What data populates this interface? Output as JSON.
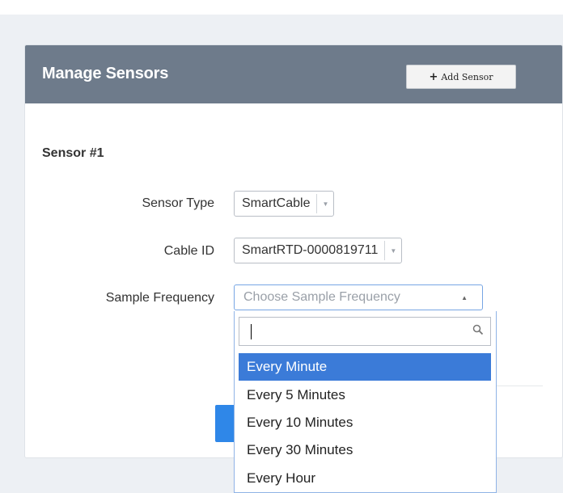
{
  "panel": {
    "title": "Manage Sensors",
    "add_button_label": "Add Sensor"
  },
  "sensor": {
    "title": "Sensor #1",
    "type_label": "Sensor Type",
    "type_value": "SmartCable",
    "cable_label": "Cable ID",
    "cable_value": "SmartRTD-0000819711",
    "freq_label": "Sample Frequency",
    "freq_placeholder": "Choose Sample Frequency"
  },
  "dropdown": {
    "search_value": "",
    "options": [
      "Every Minute",
      "Every 5 Minutes",
      "Every 10 Minutes",
      "Every 30 Minutes",
      "Every Hour"
    ],
    "highlighted": "Every Minute"
  },
  "colors": {
    "header_bg": "#6e7b8b",
    "highlight": "#3b7bd8",
    "primary_button": "#2f87e8"
  }
}
